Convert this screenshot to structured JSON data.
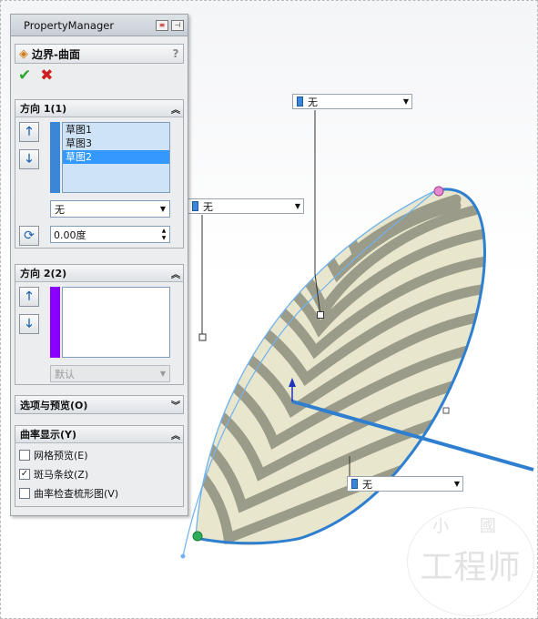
{
  "viewport_callouts": {
    "top": {
      "value": "无"
    },
    "left": {
      "value": "无"
    },
    "bottom": {
      "value": "无"
    }
  },
  "watermark": {
    "top": "小 國",
    "main": "工程师"
  },
  "property_manager": {
    "title": "PropertyManager",
    "feature_title": "边界-曲面",
    "help": "?",
    "groups": {
      "direction1": {
        "title": "方向 1(1)",
        "items": [
          {
            "label": "草图1",
            "selected": false
          },
          {
            "label": "草图3",
            "selected": false
          },
          {
            "label": "草图2",
            "selected": true
          }
        ],
        "tangency": "无",
        "angle": "0.00度"
      },
      "direction2": {
        "title": "方向 2(2)",
        "tangency": "默认"
      },
      "options": {
        "title": "选项与预览(O)"
      },
      "curvature": {
        "title": "曲率显示(Y)",
        "checkboxes": [
          {
            "label": "网格预览(E)",
            "checked": false
          },
          {
            "label": "斑马条纹(Z)",
            "checked": true
          },
          {
            "label": "曲率检查梳形图(V)",
            "checked": false
          }
        ]
      }
    }
  },
  "colors": {
    "accent_blue": "#3b86d6",
    "surface": "#e8e6cc",
    "zebra": "#9b9b8a",
    "edge": "#2f7fd0",
    "dir2_strip": "#8a00ff"
  }
}
